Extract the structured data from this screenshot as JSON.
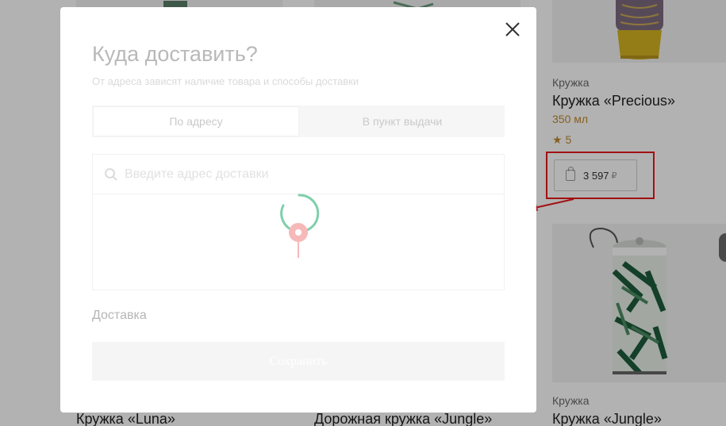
{
  "background": {
    "product_precious": {
      "category": "Кружка",
      "title": "Кружка «Precious»",
      "volume": "350 мл",
      "rating": "5",
      "price": "3 597",
      "currency": "₽"
    },
    "product_jungle_right": {
      "category": "Кружка",
      "title": "Кружка «Jungle»"
    },
    "bottom_titles": {
      "luna": "Кружка «Luna»",
      "travel_jungle": "Дорожная кружка «Jungle»"
    },
    "colors": {
      "highlight": "#e8181c",
      "accent": "#c08a2e"
    }
  },
  "modal": {
    "title": "Куда доставить?",
    "subtitle": "От адреса зависят наличие товара и способы доставки",
    "tabs": [
      {
        "label": "По адресу",
        "active": true
      },
      {
        "label": "В пункт выдачи",
        "active": false
      }
    ],
    "search": {
      "placeholder": "Введите адрес доставки",
      "value": ""
    },
    "delivery_label": "Доставка",
    "save_label": "Сохранить",
    "icons": {
      "close": "close-icon",
      "search": "search-icon",
      "loading": "spinner-icon",
      "pin": "map-pin-icon"
    },
    "colors": {
      "spinner": "#7fcfab",
      "pin": "#f08a8a"
    }
  }
}
